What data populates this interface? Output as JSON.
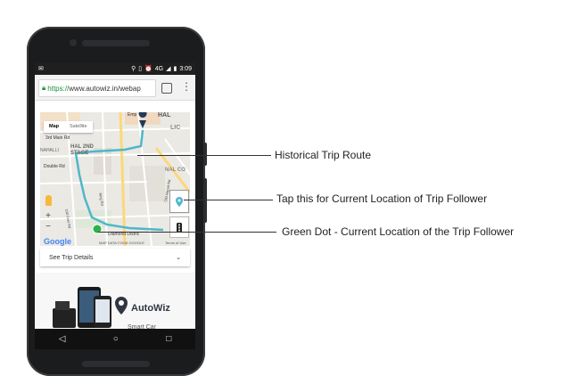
{
  "status_bar": {
    "network": "4G",
    "time": "3:09"
  },
  "browser": {
    "url_scheme": "https://",
    "url_rest": "www.autowiz.in/webap",
    "tabs_count": ""
  },
  "map": {
    "type_map": "Map",
    "type_satellite": "Satellite",
    "zoom_in": "+",
    "zoom_out": "−",
    "google": "Google",
    "attribution": "MAP DATA ©2016 GOOGLE",
    "terms": "Terms of Use",
    "labels": {
      "label_1": "Emp",
      "label_2": "HAL",
      "label_3": "LIC",
      "label_4": "3rd Main Rd",
      "label_5": "HAL 2ND STAGE",
      "label_6": "NAHALLI",
      "label_7": "Double Rd",
      "label_8": "NAL CO",
      "label_9": "Diamond Distric",
      "label_10": "100 Feet Rd",
      "label_11": "Ring Rd",
      "label_12": "Old Airport Rd"
    },
    "route_color": "#4fb7c9",
    "dot_color": "#2bb34a",
    "marker_color": "#1f3a5a"
  },
  "trip_details": {
    "label": "See Trip Details",
    "chevron": "⌄"
  },
  "promo": {
    "brand": "AutoWiz",
    "tagline": "Smart Car"
  },
  "callouts": {
    "historical_route": "Historical Trip Route",
    "current_location_button": "Tap this for Current Location of Trip Follower",
    "green_dot": "Green Dot - Current Location of the Trip Follower"
  }
}
